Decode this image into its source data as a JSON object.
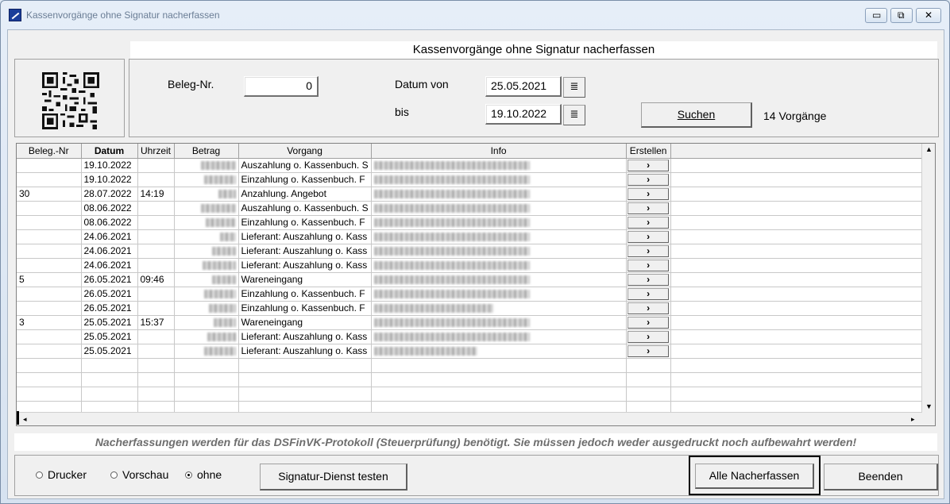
{
  "window": {
    "title": "Kassenvorgänge ohne Signatur nacherfassen",
    "minimize_glyph": "▭",
    "maximize_glyph": "⧉",
    "close_glyph": "✕"
  },
  "heading": "Kassenvorgänge ohne Signatur nacherfassen",
  "search": {
    "beleg_label": "Beleg-Nr.",
    "beleg_value": "0",
    "datum_von_label": "Datum von",
    "datum_von_value": "25.05.2021",
    "bis_label": "bis",
    "bis_value": "19.10.2022",
    "calendar_glyph": "≣",
    "suchen_label": "Suchen",
    "count_text": "14 Vorgänge"
  },
  "table": {
    "columns": [
      "Beleg.-Nr",
      "Datum",
      "Uhrzeit",
      "Betrag",
      "Vorgang",
      "Info",
      "Erstellen"
    ],
    "rows": [
      {
        "beleg": "",
        "datum": "19.10.2022",
        "uhrzeit": "",
        "vorgang": "Auszahlung o. Kassenbuch. S"
      },
      {
        "beleg": "",
        "datum": "19.10.2022",
        "uhrzeit": "",
        "vorgang": "Einzahlung o. Kassenbuch. F"
      },
      {
        "beleg": "30",
        "datum": "28.07.2022",
        "uhrzeit": "14:19",
        "vorgang": "Anzahlung. Angebot"
      },
      {
        "beleg": "",
        "datum": "08.06.2022",
        "uhrzeit": "",
        "vorgang": "Auszahlung o. Kassenbuch. S"
      },
      {
        "beleg": "",
        "datum": "08.06.2022",
        "uhrzeit": "",
        "vorgang": "Einzahlung o. Kassenbuch. F"
      },
      {
        "beleg": "",
        "datum": "24.06.2021",
        "uhrzeit": "",
        "vorgang": "Lieferant: Auszahlung o. Kass"
      },
      {
        "beleg": "",
        "datum": "24.06.2021",
        "uhrzeit": "",
        "vorgang": "Lieferant: Auszahlung o. Kass"
      },
      {
        "beleg": "",
        "datum": "24.06.2021",
        "uhrzeit": "",
        "vorgang": "Lieferant: Auszahlung o. Kass"
      },
      {
        "beleg": "5",
        "datum": "26.05.2021",
        "uhrzeit": "09:46",
        "vorgang": "Wareneingang"
      },
      {
        "beleg": "",
        "datum": "26.05.2021",
        "uhrzeit": "",
        "vorgang": "Einzahlung o. Kassenbuch. F"
      },
      {
        "beleg": "",
        "datum": "26.05.2021",
        "uhrzeit": "",
        "vorgang": "Einzahlung o. Kassenbuch. F"
      },
      {
        "beleg": "3",
        "datum": "25.05.2021",
        "uhrzeit": "15:37",
        "vorgang": "Wareneingang"
      },
      {
        "beleg": "",
        "datum": "25.05.2021",
        "uhrzeit": "",
        "vorgang": "Lieferant: Auszahlung o. Kass"
      },
      {
        "beleg": "",
        "datum": "25.05.2021",
        "uhrzeit": "",
        "vorgang": "Lieferant: Auszahlung o. Kass"
      }
    ],
    "erstellen_glyph": "›",
    "empty_rows": 4
  },
  "note": "Nacherfassungen werden für das DSFinVK-Protokoll (Steuerprüfung) benötigt. Sie müssen jedoch weder ausgedruckt noch aufbewahrt werden!",
  "output": {
    "options": [
      "Drucker",
      "Vorschau",
      "ohne"
    ],
    "selected": "ohne"
  },
  "buttons": {
    "signatur_test": "Signatur-Dienst testen",
    "alle_nacherfassen": "Alle Nacherfassen",
    "beenden": "Beenden"
  },
  "icons": {
    "app": "app-icon",
    "qr": "qr-code-icon",
    "calendar": "calendar-icon",
    "chevron": "chevron-right-icon",
    "scroll_up": "scroll-up-icon",
    "scroll_down": "scroll-down-icon",
    "scroll_left": "scroll-left-icon",
    "scroll_right": "scroll-right-icon"
  }
}
